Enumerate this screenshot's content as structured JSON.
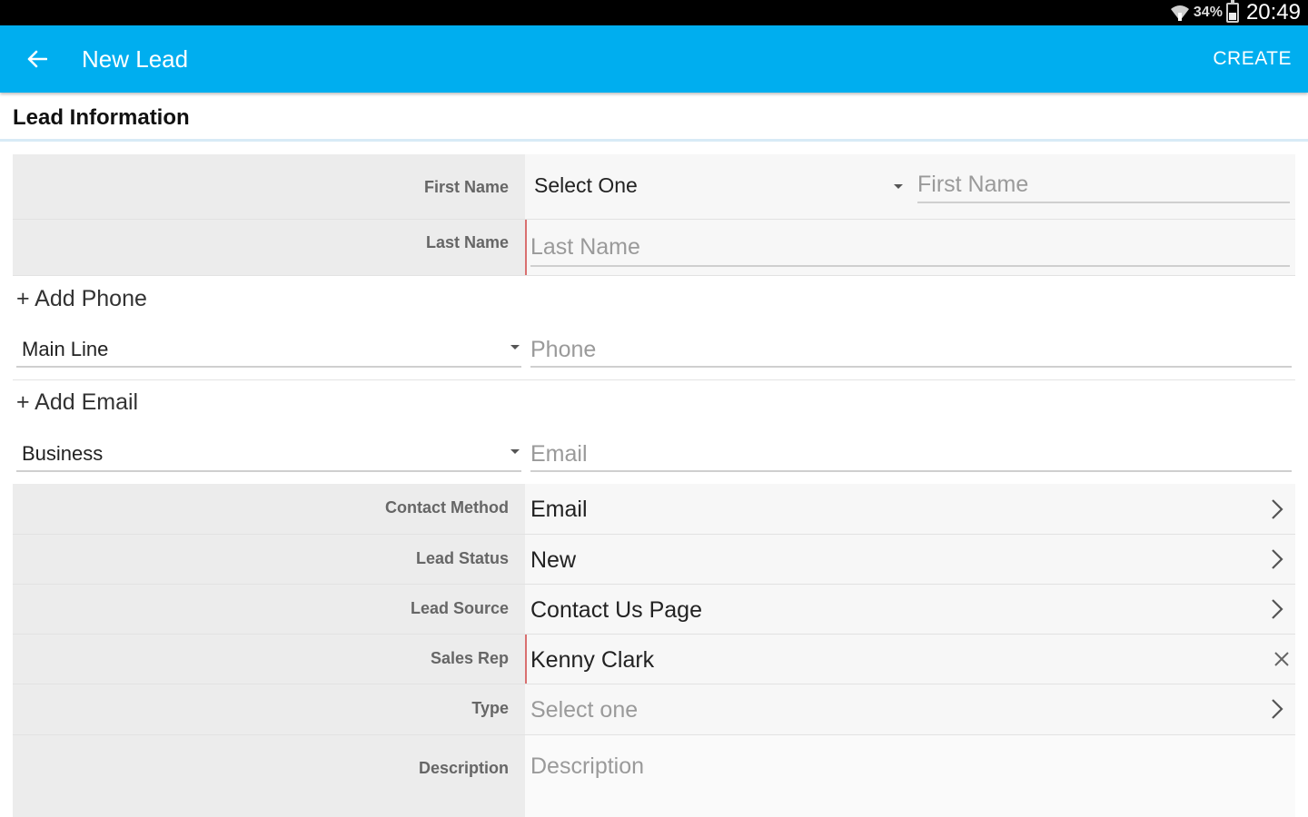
{
  "status_bar": {
    "battery": "34%",
    "time": "20:49"
  },
  "app_bar": {
    "title": "New Lead",
    "action": "CREATE"
  },
  "section": {
    "title": "Lead Information"
  },
  "name": {
    "first_label": "First Name",
    "salutation": "Select One",
    "first_placeholder": "First Name",
    "last_label": "Last Name",
    "last_placeholder": "Last Name"
  },
  "phone": {
    "add_label": "+ Add Phone",
    "type": "Main Line",
    "placeholder": "Phone"
  },
  "email": {
    "add_label": "+ Add Email",
    "type": "Business",
    "placeholder": "Email"
  },
  "fields": [
    {
      "label": "Contact Method",
      "value": "Email"
    },
    {
      "label": "Lead Status",
      "value": "New"
    },
    {
      "label": "Lead Source",
      "value": "Contact Us Page"
    },
    {
      "label": "Sales Rep",
      "value": "Kenny Clark"
    },
    {
      "label": "Type",
      "value": "Select one"
    },
    {
      "label": "Description",
      "value": "Description"
    }
  ],
  "colors": {
    "accent": "#00aeef",
    "required": "#d97070"
  }
}
